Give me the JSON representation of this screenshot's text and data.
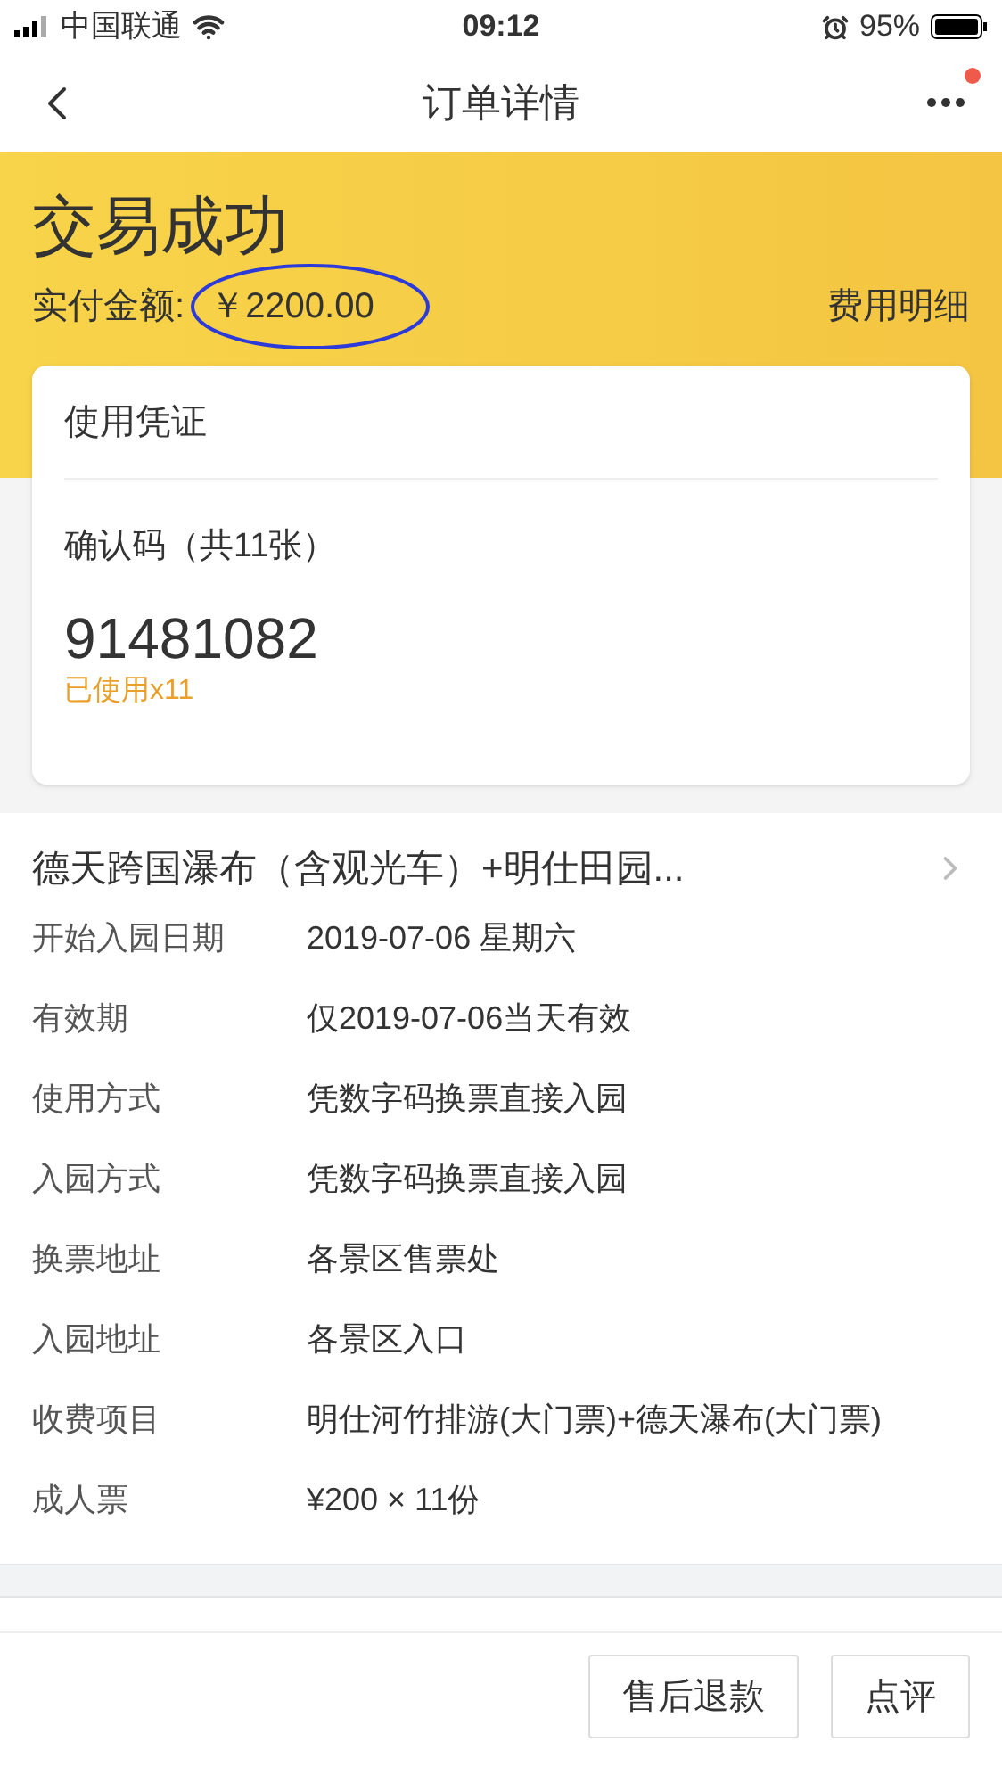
{
  "status_bar": {
    "carrier": "中国联通",
    "time": "09:12",
    "battery": "95%"
  },
  "nav": {
    "title": "订单详情",
    "has_notification": true
  },
  "header": {
    "status": "交易成功",
    "amount_label": "实付金额:",
    "amount": "￥2200.00",
    "fee_link": "费用明细"
  },
  "voucher": {
    "title": "使用凭证",
    "code_label": "确认码（共11张）",
    "code": "91481082",
    "usage": "已使用x11"
  },
  "product": {
    "title": "德天跨国瀑布（含观光车）+明仕田园...",
    "details": [
      {
        "label": "开始入园日期",
        "value": "2019-07-06 星期六"
      },
      {
        "label": "有效期",
        "value": "仅2019-07-06当天有效"
      },
      {
        "label": "使用方式",
        "value": "凭数字码换票直接入园"
      },
      {
        "label": "入园方式",
        "value": "凭数字码换票直接入园"
      },
      {
        "label": "换票地址",
        "value": "各景区售票处"
      },
      {
        "label": "入园地址",
        "value": "各景区入口"
      },
      {
        "label": "收费项目",
        "value": "明仕河竹排游(大门票)+德天瀑布(大门票)"
      },
      {
        "label": "成人票",
        "value": "¥200 × 11份"
      }
    ]
  },
  "actions": [
    "售后退款",
    "点评"
  ]
}
